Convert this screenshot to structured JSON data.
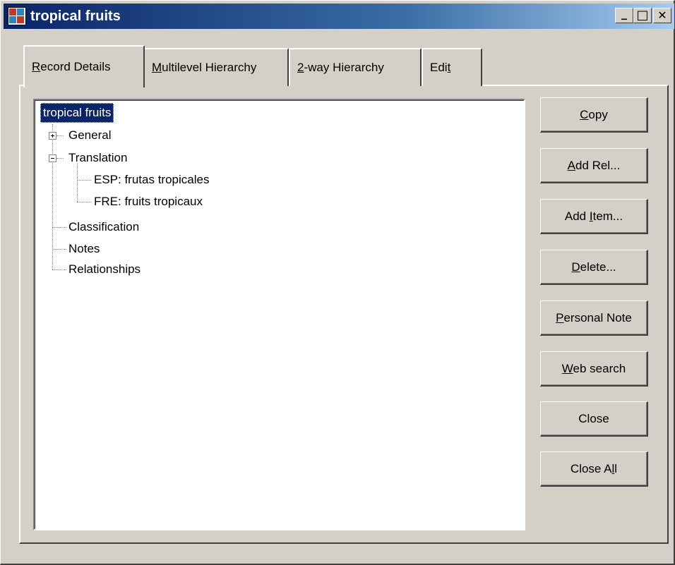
{
  "window": {
    "title": "tropical fruits",
    "controls": {
      "minimize": "_",
      "maximize": "□",
      "close": "✕"
    }
  },
  "tabs": [
    {
      "pre": "",
      "accel": "R",
      "post": "ecord Details",
      "active": true
    },
    {
      "pre": "",
      "accel": "M",
      "post": "ultilevel Hierarchy",
      "active": false
    },
    {
      "pre": "",
      "accel": "2",
      "post": "-way Hierarchy",
      "active": false
    },
    {
      "pre": "Edi",
      "accel": "t",
      "post": "",
      "active": false
    }
  ],
  "tree": {
    "root": "tropical fruits",
    "items": {
      "general": "General",
      "translation": "Translation",
      "esp": "ESP:  frutas tropicales",
      "fre": "FRE:  fruits tropicaux",
      "classification": "Classification",
      "notes": "Notes",
      "relationships": "Relationships"
    }
  },
  "buttons": {
    "copy": {
      "pre": "",
      "accel": "C",
      "post": "opy"
    },
    "add_rel": {
      "pre": "",
      "accel": "A",
      "post": "dd Rel..."
    },
    "add_item": {
      "pre": "Add ",
      "accel": "I",
      "post": "tem..."
    },
    "delete": {
      "pre": "",
      "accel": "D",
      "post": "elete..."
    },
    "personal": {
      "pre": "",
      "accel": "P",
      "post": "ersonal Note"
    },
    "web": {
      "pre": "",
      "accel": "W",
      "post": "eb search"
    },
    "close": {
      "pre": "Close",
      "accel": "",
      "post": ""
    },
    "close_all": {
      "pre": "Close A",
      "accel": "l",
      "post": "l"
    }
  },
  "colors": {
    "face": "#d4d0c8",
    "selection": "#0a246a",
    "title_start": "#0a246a",
    "title_end": "#a6caf0"
  }
}
